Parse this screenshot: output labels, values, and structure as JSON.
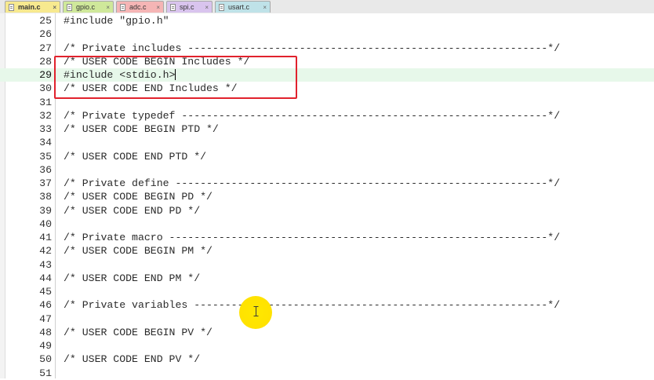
{
  "tabs": [
    {
      "label": "main.c",
      "color": "#f7e98f",
      "active": true
    },
    {
      "label": "gpio.c",
      "color": "#cfe89a",
      "active": false
    },
    {
      "label": "adc.c",
      "color": "#f5b5b5",
      "active": false
    },
    {
      "label": "spi.c",
      "color": "#d9c4ee",
      "active": false
    },
    {
      "label": "usart.c",
      "color": "#bfe2e8",
      "active": false
    }
  ],
  "lines": [
    {
      "num": "25",
      "text": "#include \"gpio.h\""
    },
    {
      "num": "26",
      "text": ""
    },
    {
      "num": "27",
      "text": "/* Private includes ----------------------------------------------------------*/"
    },
    {
      "num": "28",
      "text": "/* USER CODE BEGIN Includes */"
    },
    {
      "num": "29",
      "text": "#include <stdio.h>",
      "current": true
    },
    {
      "num": "30",
      "text": "/* USER CODE END Includes */"
    },
    {
      "num": "31",
      "text": ""
    },
    {
      "num": "32",
      "text": "/* Private typedef -----------------------------------------------------------*/"
    },
    {
      "num": "33",
      "text": "/* USER CODE BEGIN PTD */"
    },
    {
      "num": "34",
      "text": ""
    },
    {
      "num": "35",
      "text": "/* USER CODE END PTD */"
    },
    {
      "num": "36",
      "text": ""
    },
    {
      "num": "37",
      "text": "/* Private define ------------------------------------------------------------*/"
    },
    {
      "num": "38",
      "text": "/* USER CODE BEGIN PD */"
    },
    {
      "num": "39",
      "text": "/* USER CODE END PD */"
    },
    {
      "num": "40",
      "text": ""
    },
    {
      "num": "41",
      "text": "/* Private macro -------------------------------------------------------------*/"
    },
    {
      "num": "42",
      "text": "/* USER CODE BEGIN PM */"
    },
    {
      "num": "43",
      "text": ""
    },
    {
      "num": "44",
      "text": "/* USER CODE END PM */"
    },
    {
      "num": "45",
      "text": ""
    },
    {
      "num": "46",
      "text": "/* Private variables ---------------------------------------------------------*/"
    },
    {
      "num": "47",
      "text": ""
    },
    {
      "num": "48",
      "text": "/* USER CODE BEGIN PV */"
    },
    {
      "num": "49",
      "text": ""
    },
    {
      "num": "50",
      "text": "/* USER CODE END PV */"
    },
    {
      "num": "51",
      "text": ""
    }
  ],
  "colors": {
    "highlight_box": "#e1222d",
    "current_line": "#e7f8ea",
    "cursor_spot": "#ffe200"
  },
  "icons": {
    "tab_file": "file-icon",
    "tab_close": "close-icon",
    "mouse_pointer": "text-cursor-icon"
  }
}
